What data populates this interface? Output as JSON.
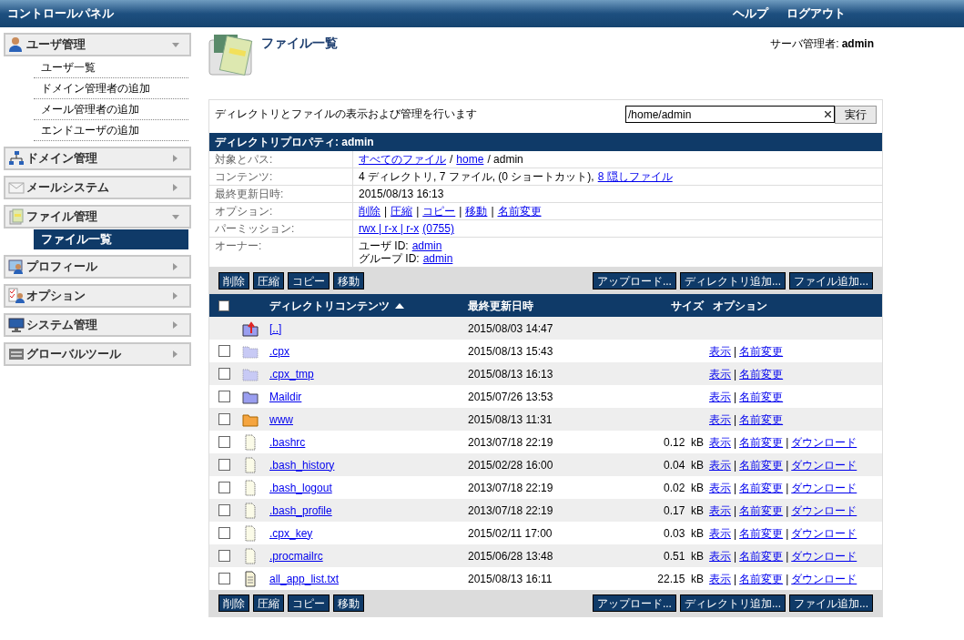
{
  "header": {
    "title": "コントロールパネル",
    "links": [
      "ヘルプ",
      "ログアウト"
    ]
  },
  "sidebar": {
    "sections": [
      {
        "label": "ユーザ管理",
        "expanded": true,
        "items": [
          {
            "label": "ユーザ一覧",
            "selected": false
          },
          {
            "label": "ドメイン管理者の追加",
            "selected": false
          },
          {
            "label": "メール管理者の追加",
            "selected": false
          },
          {
            "label": "エンドユーザの追加",
            "selected": false
          }
        ]
      },
      {
        "label": "ドメイン管理",
        "expanded": false
      },
      {
        "label": "メールシステム",
        "expanded": false
      },
      {
        "label": "ファイル管理",
        "expanded": true,
        "items": [
          {
            "label": "ファイル一覧",
            "selected": true
          }
        ]
      },
      {
        "label": "プロフィール",
        "expanded": false
      },
      {
        "label": "オプション",
        "expanded": false
      },
      {
        "label": "システム管理",
        "expanded": false
      },
      {
        "label": "グローバルツール",
        "expanded": false
      }
    ]
  },
  "page": {
    "title": "ファイル一覧",
    "user_label": "サーバ管理者:",
    "user": "admin"
  },
  "panel": {
    "description": "ディレクトリとファイルの表示および管理を行います",
    "path_field": {
      "value": "/home/admin"
    },
    "go_button": "実行",
    "properties": {
      "title": "ディレクトリプロパティ: admin",
      "rows": [
        {
          "label": "対象とパス:",
          "lines": [
            [
              {
                "text": "すべてのファイル",
                "link": true
              },
              {
                "text": "/",
                "link": false
              },
              {
                "text": "home",
                "link": true
              },
              {
                "text": "/ admin",
                "link": false
              }
            ]
          ]
        },
        {
          "label": "コンテンツ:",
          "lines": [
            [
              {
                "text": "4 ディレクトリ, 7 ファイル, (0 ショートカット),",
                "link": false
              },
              {
                "text": "8 隠しファイル",
                "link": true
              }
            ]
          ]
        },
        {
          "label": "最終更新日時:",
          "lines": [
            [
              {
                "text": "2015/08/13 16:13",
                "link": false
              }
            ]
          ]
        },
        {
          "label": "オプション:",
          "lines": [
            [
              {
                "text": "削除",
                "link": true
              },
              {
                "text": "|",
                "link": false
              },
              {
                "text": "圧縮",
                "link": true
              },
              {
                "text": "|",
                "link": false
              },
              {
                "text": "コピー",
                "link": true
              },
              {
                "text": "|",
                "link": false
              },
              {
                "text": "移動",
                "link": true
              },
              {
                "text": "|",
                "link": false
              },
              {
                "text": "名前変更",
                "link": true
              }
            ]
          ]
        },
        {
          "label": "パーミッション:",
          "lines": [
            [
              {
                "text": "rwx | r-x | r-x",
                "link": true
              },
              {
                "text": "(0755)",
                "link": true
              }
            ]
          ]
        },
        {
          "label": "オーナー:",
          "lines": [
            [
              {
                "text": "ユーザ ID:",
                "link": false
              },
              {
                "text": "admin",
                "link": true
              }
            ],
            [
              {
                "text": "グループ ID:",
                "link": false
              },
              {
                "text": "admin",
                "link": true
              }
            ]
          ]
        }
      ]
    },
    "toolbar_top": {
      "left": [
        "削除",
        "圧縮",
        "コピー",
        "移動"
      ],
      "right": [
        "アップロード...",
        "ディレクトリ追加...",
        "ファイル追加..."
      ]
    },
    "table": {
      "select_all": {
        "checked": false
      },
      "columns": [
        {
          "label": "ディレクトリコンテンツ",
          "sorted": true
        },
        {
          "label": "最終更新日時",
          "sorted": false
        },
        {
          "label": "サイズ",
          "sorted": false
        },
        {
          "label": "オプション",
          "sorted": false
        }
      ],
      "option_separator": "|",
      "rows": [
        {
          "kind": "up",
          "name": "[..]",
          "date": "2015/08/03 14:47"
        },
        {
          "kind": "hidden_folder",
          "checked": false,
          "name": ".cpx",
          "date": "2015/08/13 15:43",
          "options": [
            "表示",
            "名前変更"
          ]
        },
        {
          "kind": "hidden_folder",
          "checked": false,
          "name": ".cpx_tmp",
          "date": "2015/08/13 16:13",
          "options": [
            "表示",
            "名前変更"
          ]
        },
        {
          "kind": "folder",
          "checked": false,
          "name": "Maildir",
          "date": "2015/07/26 13:53",
          "options": [
            "表示",
            "名前変更"
          ]
        },
        {
          "kind": "web_folder",
          "checked": false,
          "name": "www",
          "date": "2015/08/13 11:31",
          "options": [
            "表示",
            "名前変更"
          ]
        },
        {
          "kind": "hidden_file",
          "checked": false,
          "name": ".bashrc",
          "date": "2013/07/18 22:19",
          "size": "0.12  kB",
          "options": [
            "表示",
            "名前変更",
            "ダウンロード"
          ]
        },
        {
          "kind": "hidden_file",
          "checked": false,
          "name": ".bash_history",
          "date": "2015/02/28 16:00",
          "size": "0.04  kB",
          "options": [
            "表示",
            "名前変更",
            "ダウンロード"
          ]
        },
        {
          "kind": "hidden_file",
          "checked": false,
          "name": ".bash_logout",
          "date": "2013/07/18 22:19",
          "size": "0.02  kB",
          "options": [
            "表示",
            "名前変更",
            "ダウンロード"
          ]
        },
        {
          "kind": "hidden_file",
          "checked": false,
          "name": ".bash_profile",
          "date": "2013/07/18 22:19",
          "size": "0.17  kB",
          "options": [
            "表示",
            "名前変更",
            "ダウンロード"
          ]
        },
        {
          "kind": "hidden_file",
          "checked": false,
          "name": ".cpx_key",
          "date": "2015/02/11 17:00",
          "size": "0.03  kB",
          "options": [
            "表示",
            "名前変更",
            "ダウンロード"
          ]
        },
        {
          "kind": "hidden_file",
          "checked": false,
          "name": ".procmailrc",
          "date": "2015/06/28 13:48",
          "size": "0.51  kB",
          "options": [
            "表示",
            "名前変更",
            "ダウンロード"
          ]
        },
        {
          "kind": "file",
          "checked": false,
          "name": "all_app_list.txt",
          "date": "2015/08/13 16:11",
          "size": "22.15  kB",
          "options": [
            "表示",
            "名前変更",
            "ダウンロード"
          ]
        }
      ]
    },
    "toolbar_bottom": {
      "left": [
        "削除",
        "圧縮",
        "コピー",
        "移動"
      ],
      "right": [
        "アップロード...",
        "ディレクトリ追加...",
        "ファイル追加..."
      ]
    }
  }
}
